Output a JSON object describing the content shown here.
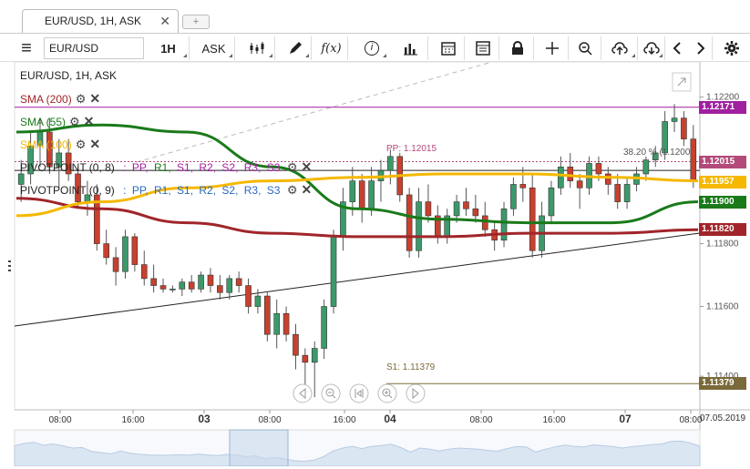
{
  "tab": {
    "title": "EUR/USD, 1H, ASK",
    "close": "✕",
    "new": "+"
  },
  "toolbar": {
    "menu": "≡",
    "symbol": "EUR/USD",
    "timeframe": "1H",
    "side": "ASK",
    "fx": "f(x)",
    "info": "i"
  },
  "chart": {
    "header": "EUR/USD, 1H, ASK",
    "indicators": {
      "sma200": "SMA (200)",
      "sma55": "SMA (55)",
      "sma100": "SMA (100)",
      "pivot8_name": "PIVOTPOINT (0, 8)",
      "pivot9_name": "PIVOTPOINT (0, 9)",
      "pivot_levels": [
        "PP,",
        "R1,",
        "S1,",
        "R2,",
        "S2,",
        "R3,",
        "S3"
      ]
    },
    "pp_label": "PP: 1.12015",
    "s1_label": "S1: 1.11379",
    "fib_label": "38.20 % (1.1200",
    "y_ticks": [
      {
        "label": "1.12200",
        "value": 1.122
      },
      {
        "label": "1.11800",
        "value": 1.1178
      },
      {
        "label": "1.11600",
        "value": 1.116
      },
      {
        "label": "1.11400",
        "value": 1.114
      }
    ],
    "price_labels": [
      {
        "label": "1.12171",
        "value": 1.12171,
        "color": "#a020a0"
      },
      {
        "label": "1.12015",
        "value": 1.12015,
        "color": "#b24a7a"
      },
      {
        "label": "1.11957",
        "value": 1.11957,
        "color": "#f5b800"
      },
      {
        "label": "1.11900",
        "value": 1.119,
        "color": "#1a7a1a"
      },
      {
        "label": "1.11820",
        "value": 1.1182,
        "color": "#a0252a"
      },
      {
        "label": "1.11379",
        "value": 1.11379,
        "color": "#7a6a3a"
      }
    ],
    "x_ticks": [
      {
        "label": "08:00",
        "bold": false
      },
      {
        "label": "16:00",
        "bold": false
      },
      {
        "label": "03",
        "bold": true
      },
      {
        "label": "08:00",
        "bold": false
      },
      {
        "label": "16:00",
        "bold": false
      },
      {
        "label": "04",
        "bold": true
      },
      {
        "label": "08:00",
        "bold": false
      },
      {
        "label": "16:00",
        "bold": false
      },
      {
        "label": "07",
        "bold": true
      },
      {
        "label": "08:00",
        "bold": false
      }
    ],
    "date_label": "07.05.2019",
    "colors": {
      "sma200": "#a0252a",
      "sma55": "#1a7a1a",
      "sma100": "#f5b800",
      "up": "#3c9a6a",
      "down": "#c8402e",
      "pivot": "#a020a0"
    }
  },
  "chart_data": {
    "type": "candlestick",
    "ylim": [
      1.1133,
      1.1228
    ],
    "candles": [
      [
        1.1195,
        1.1202,
        1.119,
        1.1198
      ],
      [
        1.1198,
        1.121,
        1.1195,
        1.1206
      ],
      [
        1.1206,
        1.1214,
        1.12,
        1.121
      ],
      [
        1.121,
        1.1214,
        1.1198,
        1.12
      ],
      [
        1.12,
        1.1208,
        1.1194,
        1.1204
      ],
      [
        1.1204,
        1.1208,
        1.1196,
        1.1198
      ],
      [
        1.1198,
        1.12,
        1.1188,
        1.119
      ],
      [
        1.119,
        1.1196,
        1.1186,
        1.1192
      ],
      [
        1.1192,
        1.1195,
        1.1176,
        1.1178
      ],
      [
        1.1178,
        1.1182,
        1.1172,
        1.1174
      ],
      [
        1.1174,
        1.1177,
        1.1166,
        1.117
      ],
      [
        1.117,
        1.1182,
        1.1168,
        1.118
      ],
      [
        1.118,
        1.1181,
        1.117,
        1.1172
      ],
      [
        1.1172,
        1.1176,
        1.1166,
        1.1168
      ],
      [
        1.1168,
        1.1172,
        1.1164,
        1.1166
      ],
      [
        1.1166,
        1.1168,
        1.1164,
        1.1165
      ],
      [
        1.1165,
        1.1166,
        1.1164,
        1.1165
      ],
      [
        1.1165,
        1.1168,
        1.1163,
        1.1167
      ],
      [
        1.1167,
        1.1169,
        1.1164,
        1.1165
      ],
      [
        1.1165,
        1.117,
        1.1164,
        1.1169
      ],
      [
        1.1169,
        1.1171,
        1.1164,
        1.1166
      ],
      [
        1.1166,
        1.1169,
        1.1162,
        1.1164
      ],
      [
        1.1164,
        1.1169,
        1.1162,
        1.1168
      ],
      [
        1.1168,
        1.117,
        1.1164,
        1.1166
      ],
      [
        1.1166,
        1.1168,
        1.1158,
        1.116
      ],
      [
        1.116,
        1.1165,
        1.1158,
        1.1163
      ],
      [
        1.1163,
        1.1164,
        1.115,
        1.1152
      ],
      [
        1.1152,
        1.1162,
        1.1148,
        1.1158
      ],
      [
        1.1158,
        1.116,
        1.115,
        1.1152
      ],
      [
        1.1152,
        1.1155,
        1.1142,
        1.1146
      ],
      [
        1.1146,
        1.1148,
        1.1136,
        1.1144
      ],
      [
        1.1144,
        1.115,
        1.1134,
        1.1148
      ],
      [
        1.1148,
        1.1162,
        1.1145,
        1.116
      ],
      [
        1.116,
        1.1182,
        1.1158,
        1.118
      ],
      [
        1.118,
        1.1194,
        1.1176,
        1.119
      ],
      [
        1.119,
        1.12,
        1.1186,
        1.1196
      ],
      [
        1.1196,
        1.1198,
        1.1184,
        1.1188
      ],
      [
        1.1188,
        1.12,
        1.1186,
        1.1196
      ],
      [
        1.1196,
        1.1202,
        1.119,
        1.1199
      ],
      [
        1.1199,
        1.1205,
        1.1195,
        1.1203
      ],
      [
        1.1203,
        1.1204,
        1.119,
        1.1192
      ],
      [
        1.1192,
        1.1194,
        1.1174,
        1.1176
      ],
      [
        1.1176,
        1.1194,
        1.1174,
        1.119
      ],
      [
        1.119,
        1.1195,
        1.1184,
        1.1186
      ],
      [
        1.1186,
        1.1189,
        1.1178,
        1.118
      ],
      [
        1.118,
        1.1188,
        1.1178,
        1.1186
      ],
      [
        1.1186,
        1.1192,
        1.1184,
        1.119
      ],
      [
        1.119,
        1.1194,
        1.1186,
        1.1188
      ],
      [
        1.1188,
        1.1192,
        1.1184,
        1.1186
      ],
      [
        1.1186,
        1.119,
        1.118,
        1.1182
      ],
      [
        1.1182,
        1.1184,
        1.1176,
        1.1179
      ],
      [
        1.1179,
        1.119,
        1.1177,
        1.1188
      ],
      [
        1.1188,
        1.1197,
        1.1186,
        1.1195
      ],
      [
        1.1195,
        1.12,
        1.119,
        1.1194
      ],
      [
        1.1194,
        1.1198,
        1.1174,
        1.1176
      ],
      [
        1.1176,
        1.119,
        1.1174,
        1.1186
      ],
      [
        1.1186,
        1.1196,
        1.1184,
        1.1194
      ],
      [
        1.1194,
        1.1203,
        1.1192,
        1.12
      ],
      [
        1.12,
        1.1204,
        1.1194,
        1.1196
      ],
      [
        1.1196,
        1.1198,
        1.1188,
        1.1194
      ],
      [
        1.1194,
        1.1203,
        1.1192,
        1.1201
      ],
      [
        1.1201,
        1.1203,
        1.1196,
        1.1198
      ],
      [
        1.1198,
        1.12,
        1.1192,
        1.1195
      ],
      [
        1.1195,
        1.1198,
        1.1188,
        1.119
      ],
      [
        1.119,
        1.1197,
        1.1188,
        1.1195
      ],
      [
        1.1195,
        1.12,
        1.1193,
        1.1198
      ],
      [
        1.1198,
        1.1203,
        1.1196,
        1.1202
      ],
      [
        1.1202,
        1.1206,
        1.12,
        1.1204
      ],
      [
        1.1204,
        1.1216,
        1.1202,
        1.1213
      ],
      [
        1.1213,
        1.1218,
        1.121,
        1.1214
      ],
      [
        1.1214,
        1.1216,
        1.1206,
        1.1208
      ],
      [
        1.1208,
        1.1212,
        1.1194,
        1.1196
      ]
    ],
    "series": [
      {
        "name": "SMA (200)",
        "values": [
          1.1191,
          1.1188,
          1.1184,
          1.1181,
          1.118,
          1.118,
          1.1181,
          1.1181,
          1.1182
        ]
      },
      {
        "name": "SMA (55)",
        "values": [
          1.121,
          1.1212,
          1.121,
          1.12,
          1.1188,
          1.1185,
          1.1184,
          1.1184,
          1.119
        ]
      },
      {
        "name": "SMA (100)",
        "values": [
          1.1186,
          1.119,
          1.1194,
          1.1196,
          1.1197,
          1.1198,
          1.1198,
          1.1197,
          1.1196
        ]
      }
    ]
  }
}
